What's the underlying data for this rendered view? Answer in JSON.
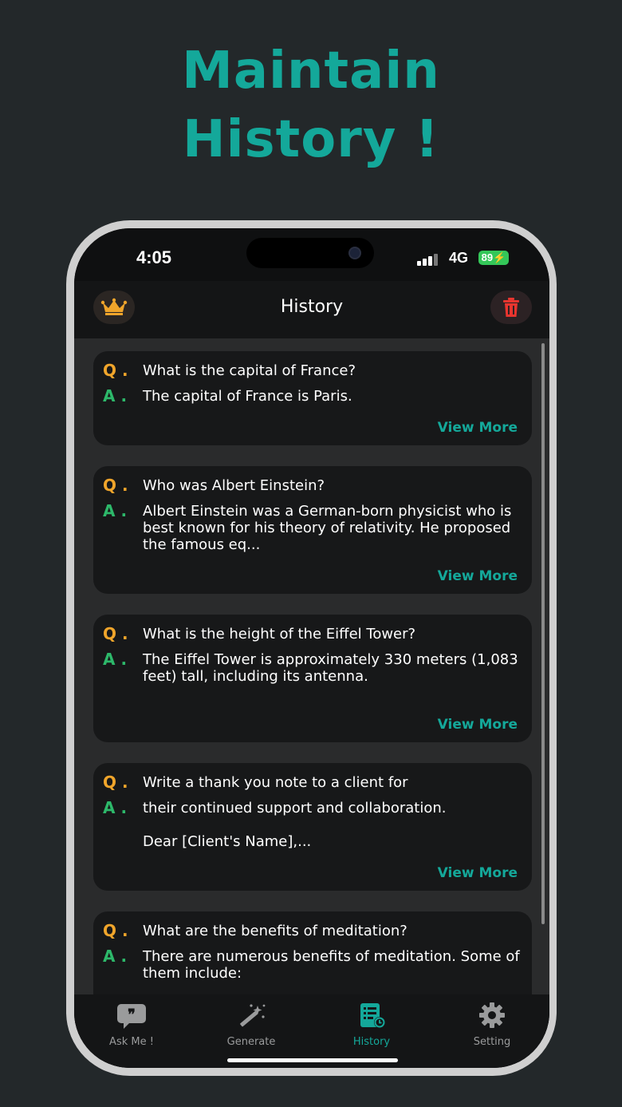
{
  "promo": {
    "line1": "Maintain",
    "line2": "History !"
  },
  "status": {
    "time": "4:05",
    "network": "4G",
    "battery": "89"
  },
  "header": {
    "title": "History"
  },
  "markers": {
    "q": "Q .",
    "a": "A ."
  },
  "history": [
    {
      "q": "What is the capital of France?",
      "a": "The capital of France is Paris.",
      "more": "View More"
    },
    {
      "q": "Who was Albert Einstein?",
      "a": "Albert Einstein was a German-born physicist who is best known for his theory of relativity. He proposed the famous eq...",
      "more": "View More"
    },
    {
      "q": "What is the height of the Eiffel Tower?",
      "a": "The Eiffel Tower is approximately 330 meters (1,083 feet) tall, including its antenna.",
      "more": "View More"
    },
    {
      "q": "Write a thank you note to a client for",
      "a": "their continued support and collaboration.",
      "a2": "Dear [Client's Name],...",
      "more": "View More"
    },
    {
      "q": "What are the benefits of meditation?",
      "a": "There are numerous benefits of meditation. Some of them include:"
    }
  ],
  "tabs": [
    {
      "label": "Ask Me !",
      "icon": "chat-bubble-icon"
    },
    {
      "label": "Generate",
      "icon": "magic-wand-icon"
    },
    {
      "label": "History",
      "icon": "history-list-icon"
    },
    {
      "label": "Setting",
      "icon": "gear-icon"
    }
  ],
  "colors": {
    "accent": "#14a89a",
    "question": "#f0a52b",
    "answer": "#2db86a",
    "delete": "#e8352f",
    "crown": "#f0a52b"
  }
}
